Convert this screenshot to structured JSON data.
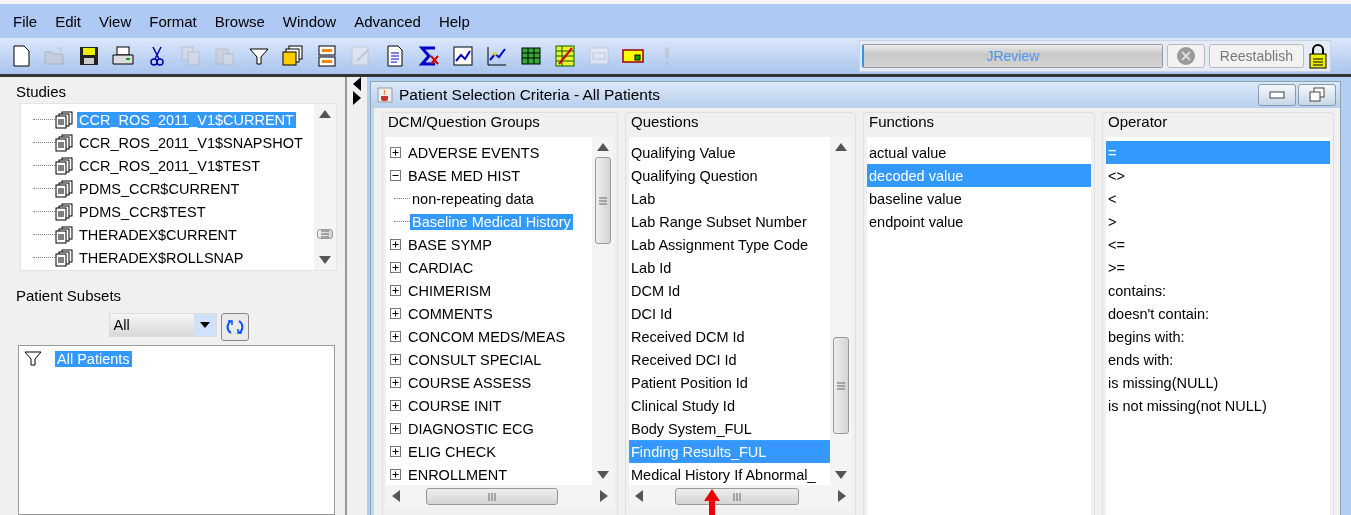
{
  "menu": [
    {
      "label": "File"
    },
    {
      "label": "Edit"
    },
    {
      "label": "View"
    },
    {
      "label": "Format"
    },
    {
      "label": "Browse"
    },
    {
      "label": "Window"
    },
    {
      "label": "Advanced"
    },
    {
      "label": "Help"
    }
  ],
  "toolbar": [
    {
      "kind": "new",
      "disabled": false
    },
    {
      "kind": "open",
      "disabled": true
    },
    {
      "kind": "save",
      "disabled": false
    },
    {
      "kind": "print",
      "disabled": false
    },
    {
      "kind": "cut",
      "disabled": false
    },
    {
      "kind": "copy",
      "disabled": true
    },
    {
      "kind": "paste",
      "disabled": true
    },
    {
      "kind": "filter",
      "disabled": false
    },
    {
      "kind": "stack",
      "disabled": false
    },
    {
      "kind": "panels",
      "disabled": false
    },
    {
      "kind": "edit",
      "disabled": true
    },
    {
      "kind": "doc",
      "disabled": false
    },
    {
      "kind": "sigma",
      "disabled": false
    },
    {
      "kind": "chartdoc",
      "disabled": false
    },
    {
      "kind": "line",
      "disabled": false
    },
    {
      "kind": "grid",
      "disabled": false
    },
    {
      "kind": "sheet",
      "disabled": false
    },
    {
      "kind": "docfile",
      "disabled": true
    },
    {
      "kind": "card",
      "disabled": false
    },
    {
      "kind": "alert",
      "disabled": true
    }
  ],
  "connection": {
    "name": "JReview",
    "stop_disabled": true,
    "reestablish": {
      "label": "Reestablish",
      "disabled": true
    }
  },
  "studies": {
    "title": "Studies",
    "items": [
      {
        "label": "CCR_ROS_2011_V1$CURRENT",
        "selected": true
      },
      {
        "label": "CCR_ROS_2011_V1$SNAPSHOT",
        "selected": false
      },
      {
        "label": "CCR_ROS_2011_V1$TEST",
        "selected": false
      },
      {
        "label": "PDMS_CCR$CURRENT",
        "selected": false
      },
      {
        "label": "PDMS_CCR$TEST",
        "selected": false
      },
      {
        "label": "THERADEX$CURRENT",
        "selected": false
      },
      {
        "label": "THERADEX$ROLLSNAP",
        "selected": false
      }
    ]
  },
  "patient_subsets": {
    "title": "Patient Subsets",
    "filter": "All",
    "items": [
      {
        "label": "All Patients",
        "selected": true
      }
    ]
  },
  "frame": {
    "title": "Patient Selection Criteria - All Patients",
    "groups": {
      "title": "DCM/Question Groups",
      "items": [
        {
          "label": "ADVERSE EVENTS",
          "expanded": false,
          "selected": false
        },
        {
          "label": "BASE MED HIST",
          "expanded": true,
          "selected": false,
          "children": [
            {
              "label": "non-repeating data",
              "selected": false
            },
            {
              "label": "Baseline Medical History",
              "selected": true
            }
          ]
        },
        {
          "label": "BASE SYMP",
          "expanded": false,
          "selected": false
        },
        {
          "label": "CARDIAC",
          "expanded": false,
          "selected": false
        },
        {
          "label": "CHIMERISM",
          "expanded": false,
          "selected": false
        },
        {
          "label": "COMMENTS",
          "expanded": false,
          "selected": false
        },
        {
          "label": "CONCOM MEDS/MEAS",
          "expanded": false,
          "selected": false
        },
        {
          "label": "CONSULT SPECIAL",
          "expanded": false,
          "selected": false
        },
        {
          "label": "COURSE ASSESS",
          "expanded": false,
          "selected": false
        },
        {
          "label": "COURSE INIT",
          "expanded": false,
          "selected": false
        },
        {
          "label": "DIAGNOSTIC ECG",
          "expanded": false,
          "selected": false
        },
        {
          "label": "ELIG CHECK",
          "expanded": false,
          "selected": false
        },
        {
          "label": "ENROLLMENT",
          "expanded": false,
          "selected": false
        }
      ]
    },
    "questions": {
      "title": "Questions",
      "items": [
        {
          "label": "Qualifying Value",
          "selected": false
        },
        {
          "label": "Qualifying Question",
          "selected": false
        },
        {
          "label": "Lab",
          "selected": false
        },
        {
          "label": "Lab Range Subset Number",
          "selected": false
        },
        {
          "label": "Lab Assignment Type Code",
          "selected": false
        },
        {
          "label": "Lab Id",
          "selected": false
        },
        {
          "label": "DCM Id",
          "selected": false
        },
        {
          "label": "DCI Id",
          "selected": false
        },
        {
          "label": "Received DCM Id",
          "selected": false
        },
        {
          "label": "Received DCI Id",
          "selected": false
        },
        {
          "label": "Patient Position Id",
          "selected": false
        },
        {
          "label": "Clinical Study Id",
          "selected": false
        },
        {
          "label": "Body System_FUL",
          "selected": false
        },
        {
          "label": "Finding Results_FUL",
          "selected": true
        },
        {
          "label": "Medical History If Abnormal_",
          "selected": false
        }
      ]
    },
    "functions": {
      "title": "Functions",
      "items": [
        {
          "label": "actual value",
          "selected": false
        },
        {
          "label": "decoded value",
          "selected": true
        },
        {
          "label": "baseline value",
          "selected": false
        },
        {
          "label": "endpoint value",
          "selected": false
        }
      ]
    },
    "operators": {
      "title": "Operator",
      "items": [
        {
          "label": "=",
          "selected": true
        },
        {
          "label": "<>",
          "selected": false
        },
        {
          "label": "<",
          "selected": false
        },
        {
          "label": ">",
          "selected": false
        },
        {
          "label": "<=",
          "selected": false
        },
        {
          "label": ">=",
          "selected": false
        },
        {
          "label": "contains:",
          "selected": false
        },
        {
          "label": "doesn't contain:",
          "selected": false
        },
        {
          "label": "begins with:",
          "selected": false
        },
        {
          "label": "ends with:",
          "selected": false
        },
        {
          "label": "is missing(NULL)",
          "selected": false
        },
        {
          "label": "is not missing(not NULL)",
          "selected": false
        }
      ]
    }
  },
  "annotation": {
    "kind": "arrow"
  }
}
